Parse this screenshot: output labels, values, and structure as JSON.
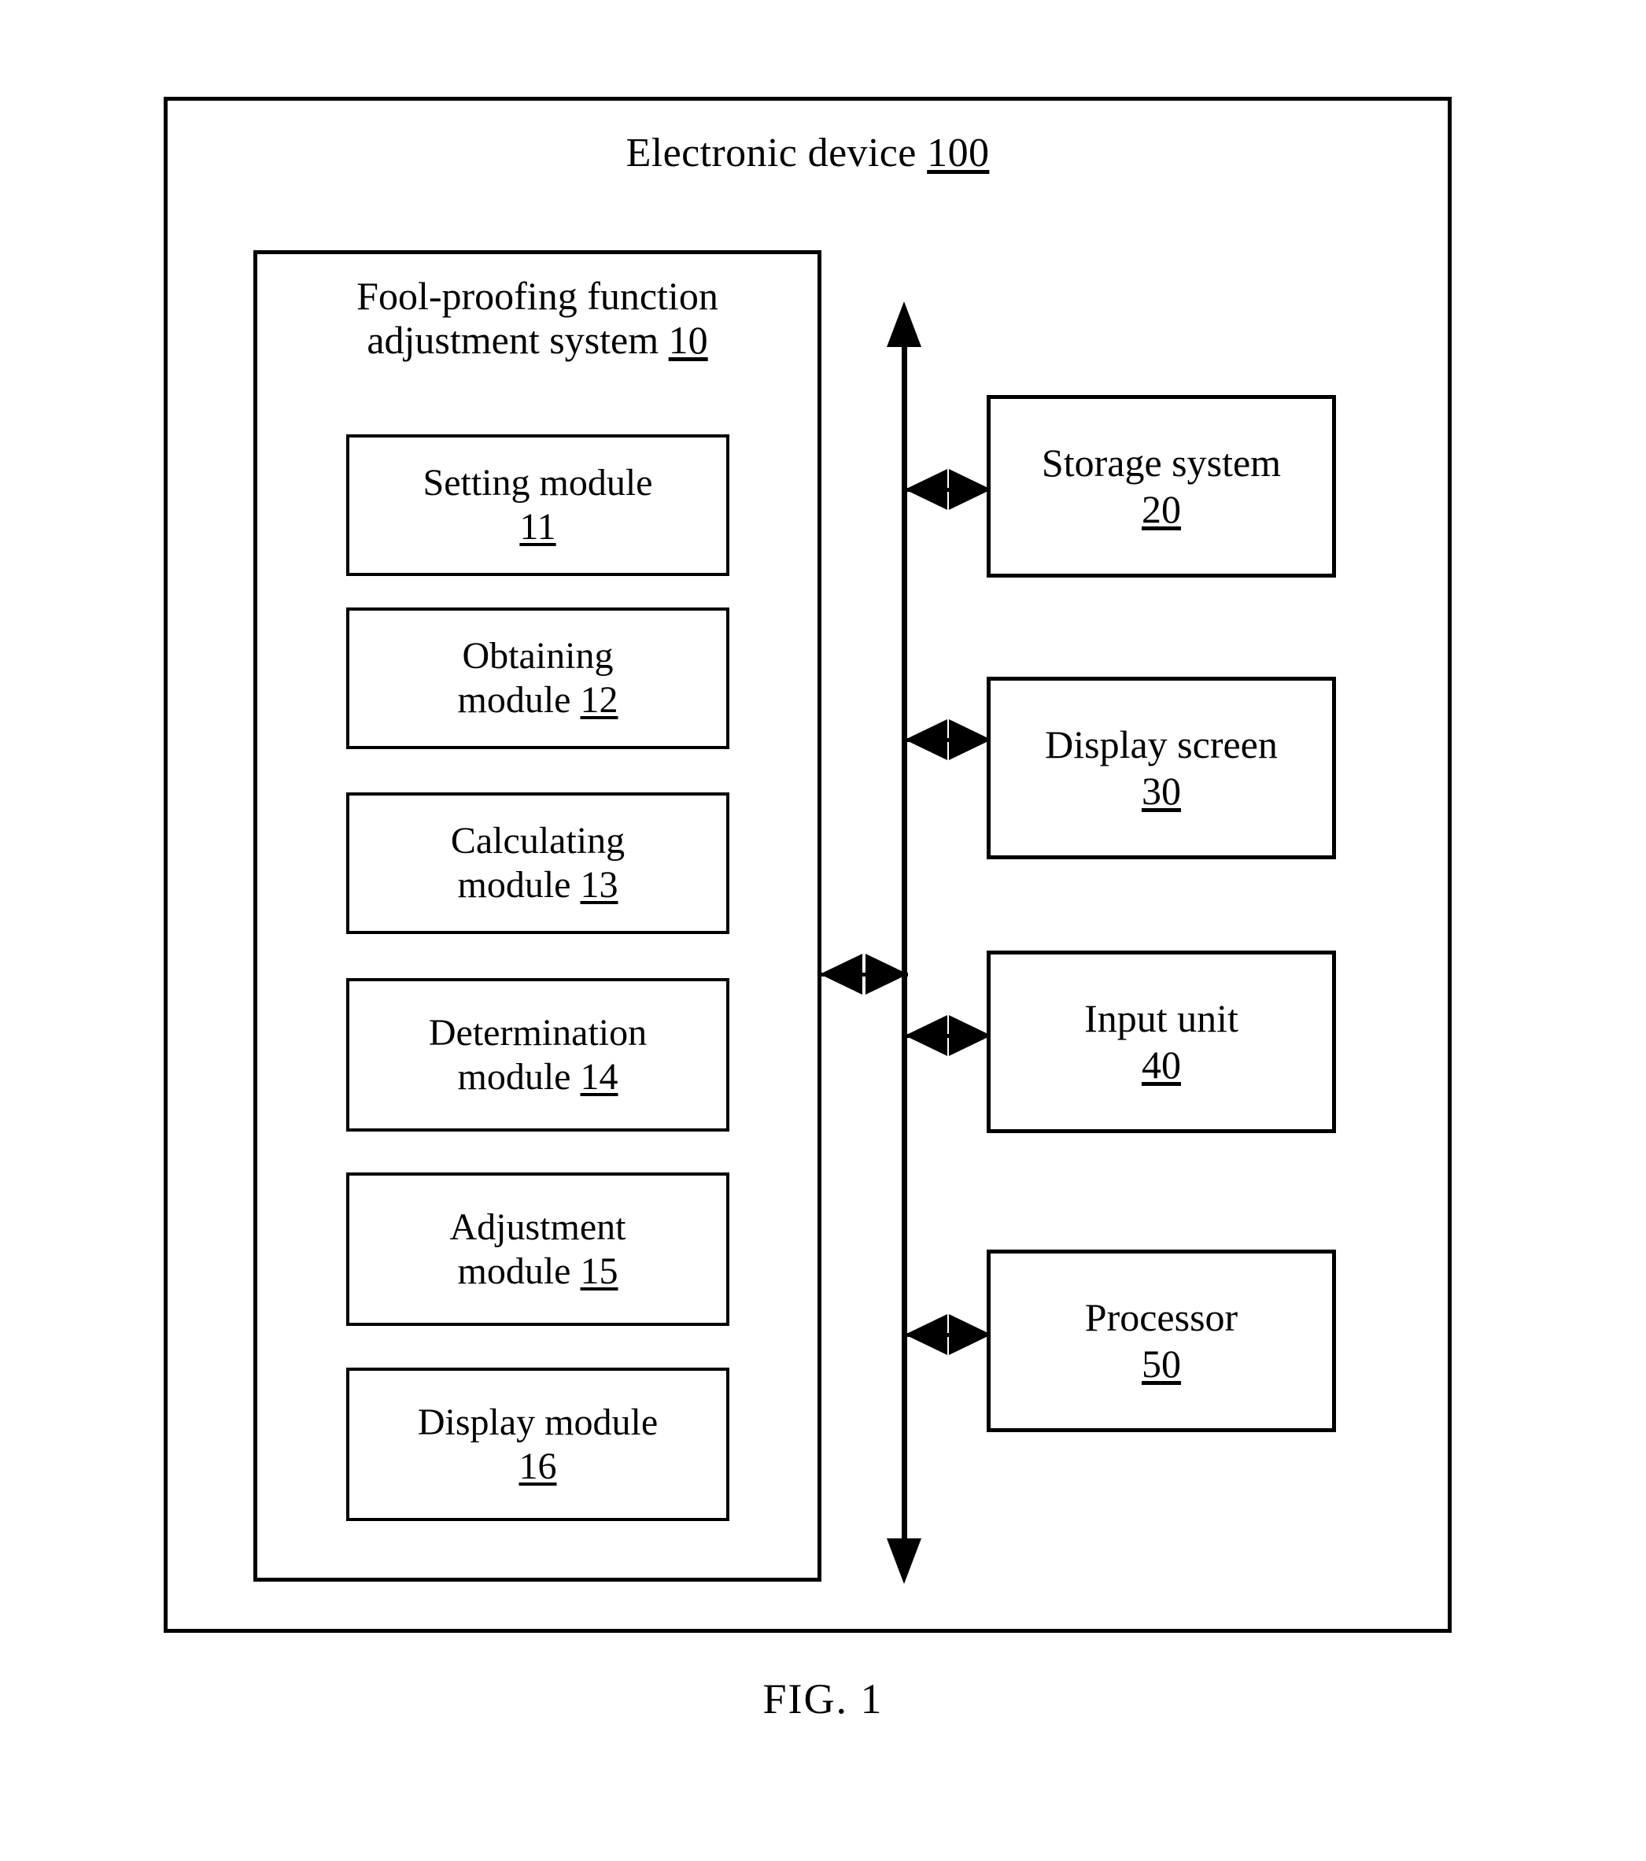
{
  "figure": {
    "caption": "FIG. 1",
    "device": {
      "label": "Electronic device",
      "ref": "100"
    },
    "system": {
      "label_line1": "Fool-proofing function",
      "label_line2": "adjustment system",
      "ref": "10",
      "modules": [
        {
          "label_line1": "Setting module",
          "label_line2": "",
          "ref": "11",
          "inline": false
        },
        {
          "label_line1": "Obtaining",
          "label_line2": "module",
          "ref": "12",
          "inline": true
        },
        {
          "label_line1": "Calculating",
          "label_line2": "module",
          "ref": "13",
          "inline": true
        },
        {
          "label_line1": "Determination",
          "label_line2": "module",
          "ref": "14",
          "inline": true
        },
        {
          "label_line1": "Adjustment",
          "label_line2": "module",
          "ref": "15",
          "inline": true
        },
        {
          "label_line1": "Display module",
          "label_line2": "",
          "ref": "16",
          "inline": false
        }
      ]
    },
    "peripherals": [
      {
        "label": "Storage system",
        "ref": "20"
      },
      {
        "label": "Display screen",
        "ref": "30"
      },
      {
        "label": "Input unit",
        "ref": "40"
      },
      {
        "label": "Processor",
        "ref": "50"
      }
    ],
    "bus": {
      "name": "communication-bus",
      "arrow_top": "up-arrowhead",
      "arrow_bottom": "down-arrowhead"
    },
    "colors": {
      "stroke": "#000000",
      "background": "#ffffff"
    }
  }
}
